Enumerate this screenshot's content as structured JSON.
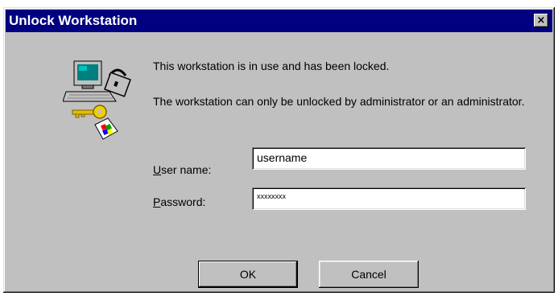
{
  "window": {
    "title": "Unlock Workstation",
    "close_glyph": "×"
  },
  "message": {
    "line1": "This workstation is in use and has been locked.",
    "line2": "The workstation can only be unlocked by administrator or an administrator."
  },
  "fields": {
    "username": {
      "label_first": "U",
      "label_rest": "ser name:",
      "value": "username"
    },
    "password": {
      "label_first": "P",
      "label_rest": "assword:",
      "value": "xxxxxxxx"
    }
  },
  "buttons": {
    "ok": "OK",
    "cancel": "Cancel"
  },
  "icons": {
    "computer": "lock-computer-icon",
    "key": "key-icon"
  },
  "colors": {
    "titlebar": "#000080",
    "face": "#c0c0c0"
  }
}
